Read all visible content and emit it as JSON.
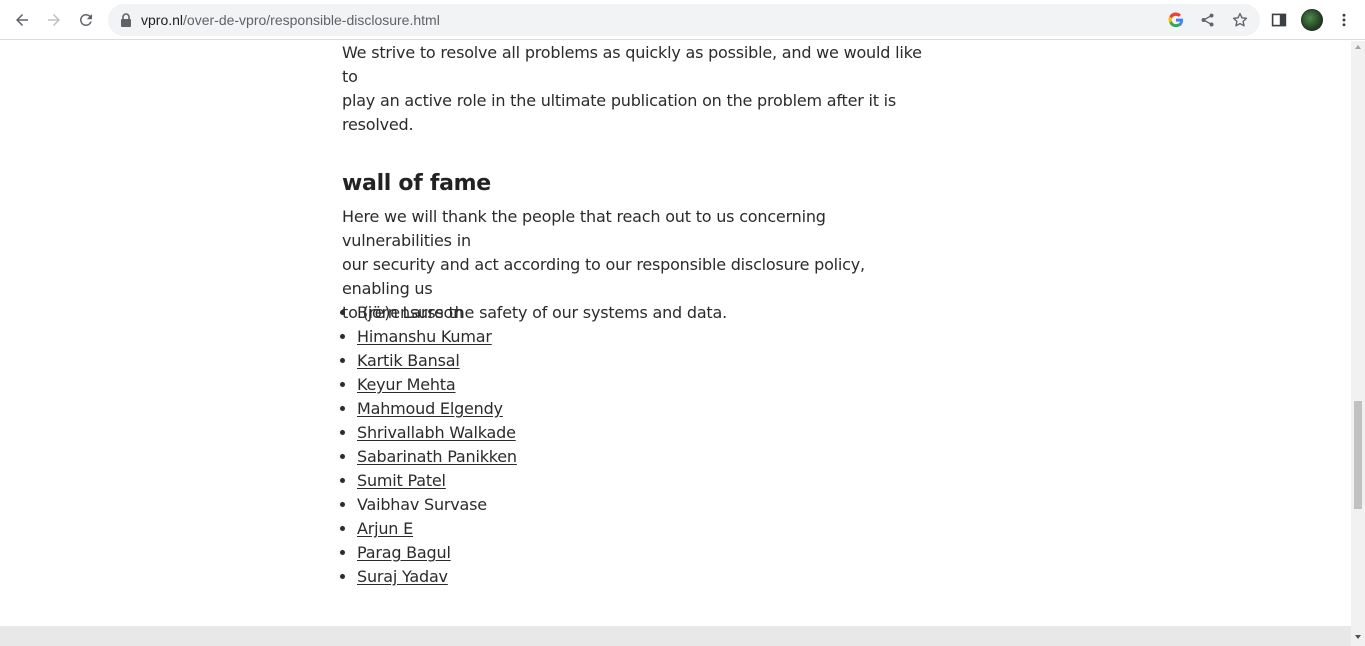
{
  "browser": {
    "url_domain": "vpro.nl",
    "url_path": "/over-de-vpro/responsible-disclosure.html",
    "icons": [
      "back-icon",
      "forward-icon",
      "reload-icon",
      "lock-icon",
      "google-icon",
      "share-icon",
      "star-icon",
      "side-panel-icon",
      "menu-icon"
    ]
  },
  "page": {
    "intro_line1": "We strive to resolve all problems as quickly as possible, and we would like to",
    "intro_line2": "play an active role in the ultimate publication on the problem after it is resolved.",
    "heading": "wall of fame",
    "body_line1": "Here we will thank the people that reach out to us concerning vulnerabilities in",
    "body_line2": "our security and act according to our responsible disclosure policy, enabling us",
    "body_line3": "to (re)ensure the safety of our systems and data.",
    "names": [
      {
        "name": "Björn Larsson",
        "link": false
      },
      {
        "name": "Himanshu Kumar",
        "link": true
      },
      {
        "name": "Kartik Bansal",
        "link": true
      },
      {
        "name": "Keyur Mehta",
        "link": true
      },
      {
        "name": "Mahmoud Elgendy",
        "link": true
      },
      {
        "name": "Shrivallabh Walkade",
        "link": true
      },
      {
        "name": "Sabarinath Panikken",
        "link": true
      },
      {
        "name": "Sumit Patel",
        "link": true
      },
      {
        "name": "Vaibhav Survase",
        "link": false
      },
      {
        "name": "Arjun E",
        "link": true
      },
      {
        "name": "Parag Bagul",
        "link": true
      },
      {
        "name": "Suraj Yadav",
        "link": true
      }
    ]
  },
  "colors": {
    "text": "#2b2b2b",
    "footer": "#e8e8e8",
    "omnibox": "#f1f3f4"
  }
}
